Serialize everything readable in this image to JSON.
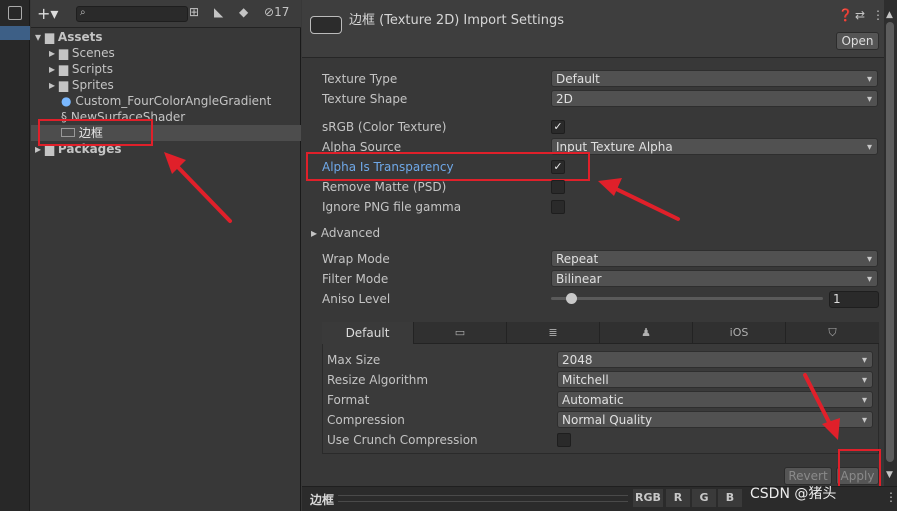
{
  "project": {
    "badge": "17",
    "search_placeholder": "",
    "tree": [
      {
        "label": "Assets",
        "icon": "folder-icon"
      },
      {
        "label": "Scenes",
        "icon": "folder-icon"
      },
      {
        "label": "Scripts",
        "icon": "folder-icon"
      },
      {
        "label": "Sprites",
        "icon": "folder-icon"
      },
      {
        "label": "Custom_FourColorAngleGradient",
        "icon": "material-icon"
      },
      {
        "label": "NewSurfaceShader",
        "icon": "shader-icon"
      },
      {
        "label": "边框",
        "icon": "texture-icon"
      },
      {
        "label": "Packages",
        "icon": "folder-icon"
      }
    ]
  },
  "header": {
    "title": "边框 (Texture 2D) Import Settings",
    "open_label": "Open"
  },
  "fields": {
    "texture_type": {
      "label": "Texture Type",
      "value": "Default"
    },
    "texture_shape": {
      "label": "Texture Shape",
      "value": "2D"
    },
    "srgb": {
      "label": "sRGB (Color Texture)",
      "checked": true
    },
    "alpha_source": {
      "label": "Alpha Source",
      "value": "Input Texture Alpha"
    },
    "alpha_transparency": {
      "label": "Alpha Is Transparency",
      "checked": true
    },
    "remove_matte": {
      "label": "Remove Matte (PSD)",
      "checked": false
    },
    "ignore_png": {
      "label": "Ignore PNG file gamma",
      "checked": false
    },
    "advanced": {
      "label": "Advanced"
    },
    "wrap_mode": {
      "label": "Wrap Mode",
      "value": "Repeat"
    },
    "filter_mode": {
      "label": "Filter Mode",
      "value": "Bilinear"
    },
    "aniso": {
      "label": "Aniso Level",
      "value": "1"
    }
  },
  "platform": {
    "tabs": {
      "default": "Default",
      "ios": "iOS"
    },
    "max_size": {
      "label": "Max Size",
      "value": "2048"
    },
    "resize": {
      "label": "Resize Algorithm",
      "value": "Mitchell"
    },
    "format": {
      "label": "Format",
      "value": "Automatic"
    },
    "compression": {
      "label": "Compression",
      "value": "Normal Quality"
    },
    "crunch": {
      "label": "Use Crunch Compression",
      "checked": false
    }
  },
  "actions": {
    "revert": "Revert",
    "apply": "Apply"
  },
  "preview": {
    "name": "边框",
    "channels": [
      "RGB",
      "R",
      "G",
      "B"
    ],
    "watermark": "CSDN @猪头"
  },
  "colors": {
    "highlight": "#e0202a",
    "alpha_label": "#6fa8e8"
  }
}
